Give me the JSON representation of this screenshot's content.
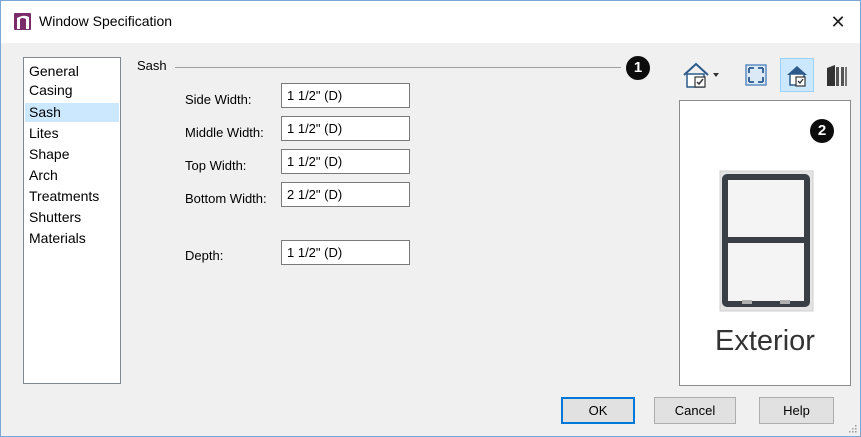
{
  "window": {
    "title": "Window Specification",
    "close_glyph": "✕"
  },
  "nav": {
    "selected": "Sash",
    "items": [
      "General",
      "Casing",
      "Sash",
      "Lites",
      "Shape",
      "Arch",
      "Treatments",
      "Shutters",
      "Materials"
    ]
  },
  "sash": {
    "group_label": "Sash",
    "fields": [
      {
        "label": "Side Width:",
        "value": "1 1/2\" (D)"
      },
      {
        "label": "Middle Width:",
        "value": "1 1/2\" (D)"
      },
      {
        "label": "Top Width:",
        "value": "1 1/2\" (D)"
      },
      {
        "label": "Bottom Width:",
        "value": "2 1/2\" (D)"
      },
      {
        "label": "Depth:",
        "value": "1 1/2\" (D)"
      }
    ]
  },
  "callouts": [
    "1",
    "2"
  ],
  "preview": {
    "caption": "Exterior"
  },
  "toolbar": {
    "icons": [
      "house-view-dropdown-icon",
      "fill-window-icon",
      "color-on-icon",
      "show-walls-icon"
    ]
  },
  "buttons": {
    "ok": "OK",
    "cancel": "Cancel",
    "help": "Help"
  },
  "colors": {
    "accent": "#0078d7",
    "selection": "#cce8ff",
    "app_icon": "#7b2a6a"
  }
}
